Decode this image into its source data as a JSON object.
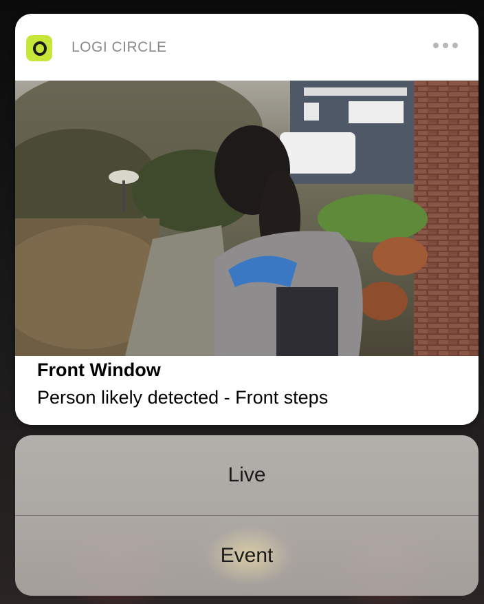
{
  "notification": {
    "app_name": "LOGI CIRCLE",
    "app_icon": "logi-circle-app-icon",
    "more_icon": "ellipsis-icon",
    "title": "Front Window",
    "body": "Person likely detected - Front steps"
  },
  "actions": {
    "live_label": "Live",
    "event_label": "Event"
  },
  "colors": {
    "app_icon_bg": "#c6e63a",
    "card_bg": "#ffffff",
    "app_name": "#8a8a8a"
  }
}
